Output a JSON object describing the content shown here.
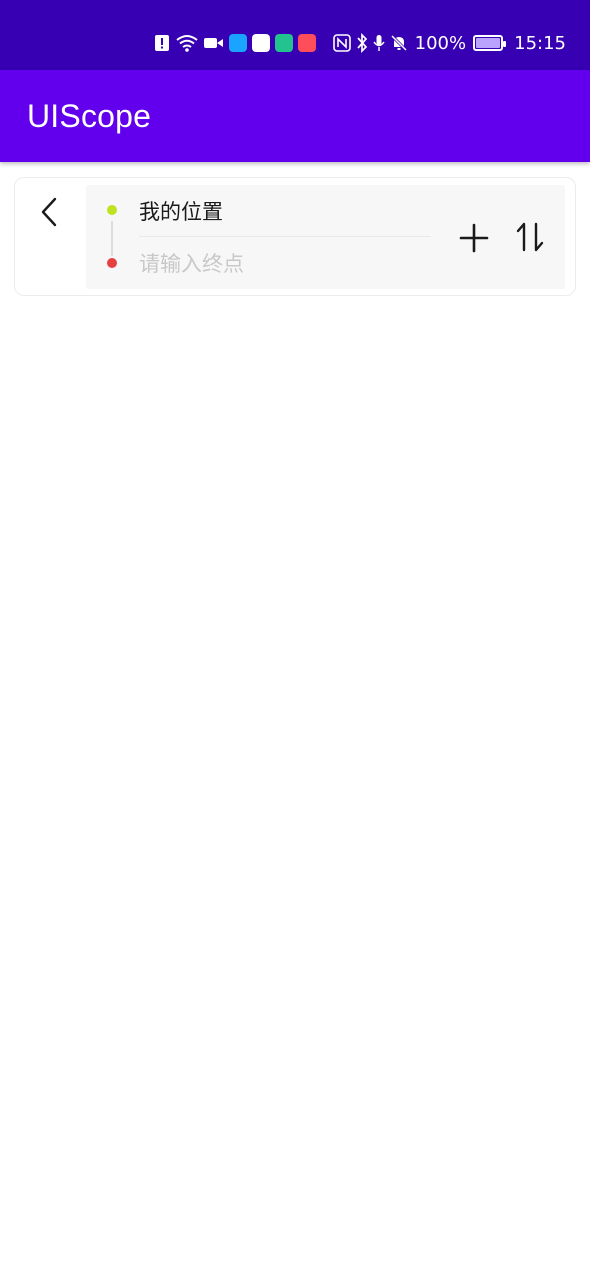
{
  "status_bar": {
    "battery_percent": "100%",
    "time": "15:15",
    "icons": [
      "alert-icon",
      "wifi-icon",
      "video-icon",
      "search-app-icon",
      "huawei-app-icon",
      "home-app-icon",
      "red-app-icon",
      "nfc-icon",
      "bluetooth-icon",
      "mic-icon",
      "mute-bell-icon",
      "battery-icon"
    ],
    "colors": {
      "background": "#3700b3"
    }
  },
  "app_bar": {
    "title": "UIScope",
    "colors": {
      "background": "#6200ee"
    }
  },
  "route": {
    "start_value": "我的位置",
    "end_placeholder": "请输入终点",
    "icons": [
      "back-arrow-icon",
      "start-dot-icon",
      "end-dot-icon",
      "plus-icon",
      "swap-icon"
    ],
    "colors": {
      "start_dot": "#bfe21e",
      "end_dot": "#e64141"
    }
  }
}
